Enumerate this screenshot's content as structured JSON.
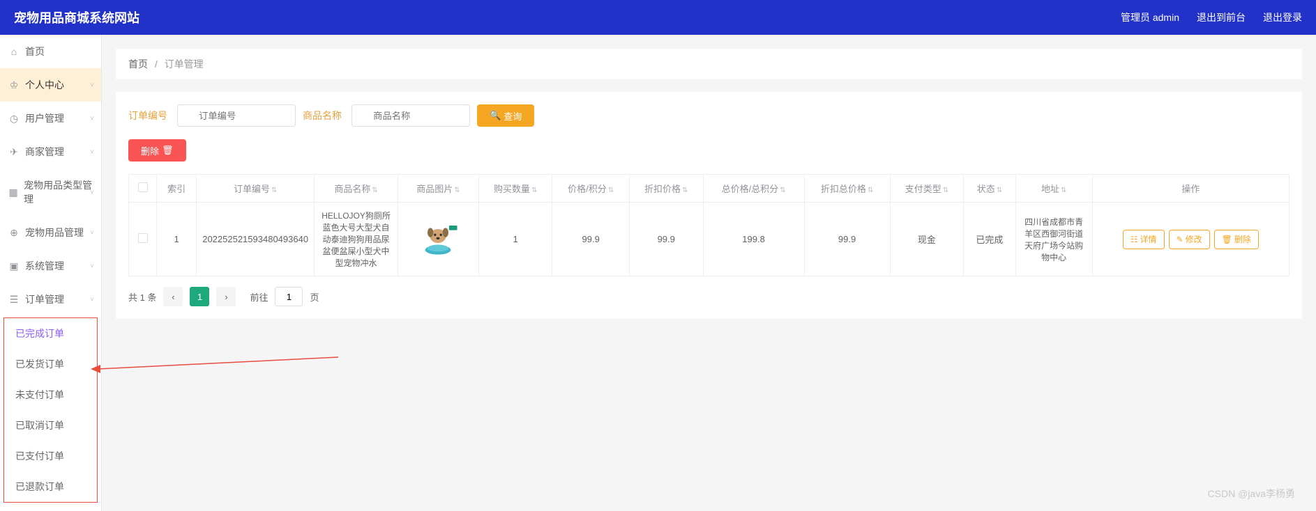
{
  "header": {
    "title": "宠物用品商城系统网站",
    "adminLabel": "管理员 admin",
    "exitFront": "退出到前台",
    "logout": "退出登录"
  },
  "sidebar": {
    "items": [
      {
        "icon": "home",
        "label": "首页"
      },
      {
        "icon": "user",
        "label": "个人中心",
        "active": true
      },
      {
        "icon": "clock",
        "label": "用户管理"
      },
      {
        "icon": "send",
        "label": "商家管理"
      },
      {
        "icon": "grid",
        "label": "宠物用品类型管理"
      },
      {
        "icon": "globe",
        "label": "宠物用品管理"
      },
      {
        "icon": "archive",
        "label": "系统管理"
      },
      {
        "icon": "list",
        "label": "订单管理"
      }
    ],
    "submenu": [
      {
        "label": "已完成订单",
        "selected": true
      },
      {
        "label": "已发货订单"
      },
      {
        "label": "未支付订单"
      },
      {
        "label": "已取消订单"
      },
      {
        "label": "已支付订单"
      },
      {
        "label": "已退款订单"
      }
    ]
  },
  "breadcrumb": {
    "home": "首页",
    "current": "订单管理"
  },
  "search": {
    "orderNoLabel": "订单编号",
    "orderNoPlaceholder": "订单编号",
    "productNameLabel": "商品名称",
    "productNamePlaceholder": "商品名称",
    "queryBtn": "查询",
    "deleteBtn": "删除"
  },
  "table": {
    "headers": [
      "索引",
      "订单编号",
      "商品名称",
      "商品图片",
      "购买数量",
      "价格/积分",
      "折扣价格",
      "总价格/总积分",
      "折扣总价格",
      "支付类型",
      "状态",
      "地址",
      "操作"
    ],
    "rows": [
      {
        "index": "1",
        "orderNo": "202252521593480493640",
        "productName": "HELLOJOY狗厕所蓝色大号大型犬自动泰迪狗狗用品尿盆便盆屎小型犬中型宠物冲水",
        "quantity": "1",
        "price": "99.9",
        "discountPrice": "99.9",
        "totalPrice": "199.8",
        "discountTotal": "99.9",
        "payType": "现金",
        "status": "已完成",
        "address": "四川省成都市青羊区西御河街道天府广场今站购物中心"
      }
    ],
    "actions": {
      "detail": "详情",
      "edit": "修改",
      "delete": "删除"
    }
  },
  "pagination": {
    "total": "共 1 条",
    "current": "1",
    "gotoLabel": "前往",
    "gotoValue": "1",
    "pageLabel": "页"
  },
  "watermark": "CSDN @java李杨勇"
}
